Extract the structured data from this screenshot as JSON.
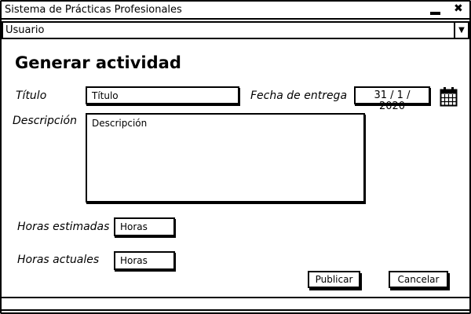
{
  "window": {
    "title": "Sistema de Prácticas Profesionales",
    "minimize_icon": "minimize-icon",
    "close_icon": "close-icon",
    "close_glyph": "✖"
  },
  "user_menu": {
    "selected": "Usuario",
    "arrow": "▼"
  },
  "form": {
    "heading": "Generar actividad",
    "title_label": "Título",
    "title_value": "Título",
    "due_label": "Fecha de entrega",
    "due_value": "31 / 1 / 2020",
    "calendar_icon": "calendar-icon",
    "desc_label": "Descripción",
    "desc_value": "Descripción",
    "est_hours_label": "Horas estimadas",
    "est_hours_value": "Horas",
    "act_hours_label": "Horas actuales",
    "act_hours_value": "Horas",
    "publish": "Publicar",
    "cancel": "Cancelar"
  }
}
